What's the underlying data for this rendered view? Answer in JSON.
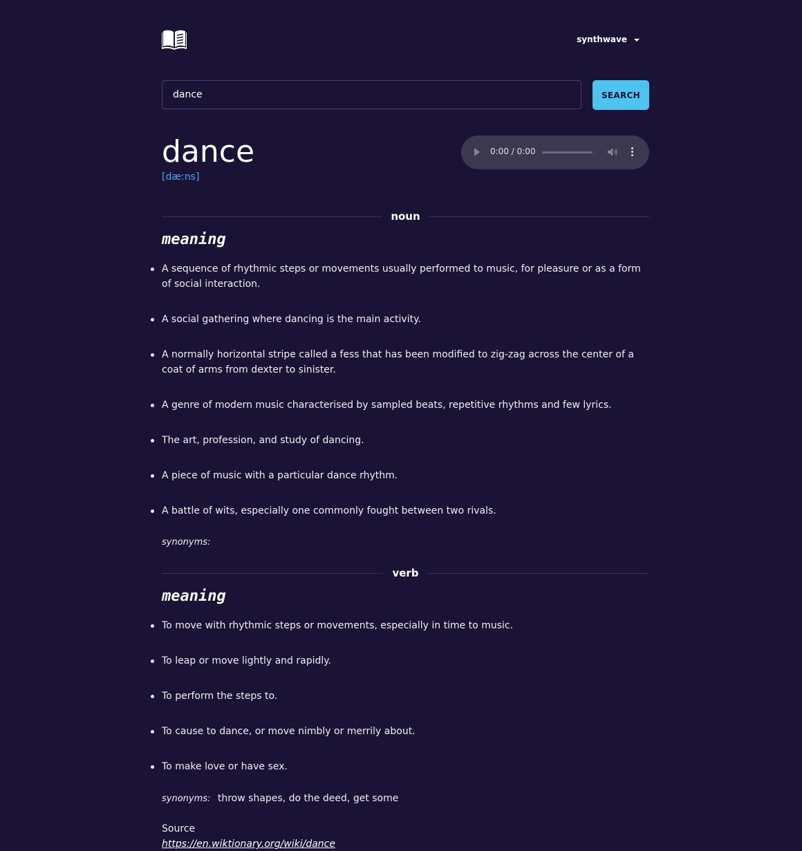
{
  "header": {
    "logo_icon": "open-book-icon",
    "theme_label": "synthwave"
  },
  "search": {
    "value": "dance",
    "placeholder": "",
    "button_label": "SEARCH"
  },
  "entry": {
    "word": "dance",
    "phonetic": "[dæːns]",
    "audio": {
      "time": "0:00 / 0:00"
    }
  },
  "sections": [
    {
      "part_of_speech": "noun",
      "meaning_heading": "meaning",
      "definitions": [
        "A sequence of rhythmic steps or movements usually performed to music, for pleasure or as a form of social interaction.",
        "A social gathering where dancing is the main activity.",
        "A normally horizontal stripe called a fess that has been modified to zig-zag across the center of a coat of arms from dexter to sinister.",
        "A genre of modern music characterised by sampled beats, repetitive rhythms and few lyrics.",
        "The art, profession, and study of dancing.",
        "A piece of music with a particular dance rhythm.",
        "A battle of wits, especially one commonly fought between two rivals."
      ],
      "synonyms_label": "synonyms:",
      "synonyms": ""
    },
    {
      "part_of_speech": "verb",
      "meaning_heading": "meaning",
      "definitions": [
        "To move with rhythmic steps or movements, especially in time to music.",
        "To leap or move lightly and rapidly.",
        "To perform the steps to.",
        "To cause to dance, or move nimbly or merrily about.",
        "To make love or have sex."
      ],
      "synonyms_label": "synonyms:",
      "synonyms": "throw shapes, do the deed, get some"
    }
  ],
  "source": {
    "label": "Source",
    "url": "https://en.wiktionary.org/wiki/dance"
  }
}
